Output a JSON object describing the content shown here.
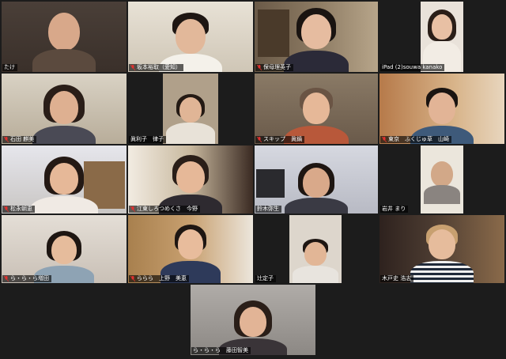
{
  "participants": [
    {
      "name": "たけ",
      "muted": false
    },
    {
      "name": "坂本裕取（愛知）",
      "muted": true,
      "active": true
    },
    {
      "name": "保母理英子",
      "muted": true
    },
    {
      "name": "iPad (2)souwa kanako",
      "muted": false
    },
    {
      "name": "石田 麒美",
      "muted": true
    },
    {
      "name": "眞利子　律子",
      "muted": false
    },
    {
      "name": "スキップ　眞鍋",
      "muted": true
    },
    {
      "name": "東京　ふくじゅ草　山崎",
      "muted": true
    },
    {
      "name": "松永朝恵",
      "muted": true
    },
    {
      "name": "江東しろつめくさ　今野",
      "muted": true
    },
    {
      "name": "鈴木弥生",
      "muted": false
    },
    {
      "name": "岩井 まり",
      "muted": false
    },
    {
      "name": "ら・ら・ら増田",
      "muted": true
    },
    {
      "name": "ららら　上野　美恵",
      "muted": true
    },
    {
      "name": "辻定子",
      "muted": false
    },
    {
      "name": "木戸史 浩志",
      "muted": false
    },
    {
      "name": "ら・ら・ら　藤田智美",
      "muted": false
    }
  ],
  "colors": {
    "background": "#1c1c1c",
    "active_speaker_border": "#2ec84a",
    "muted_icon": "#e0312f"
  },
  "icons": {
    "muted": "microphone-muted-icon"
  }
}
